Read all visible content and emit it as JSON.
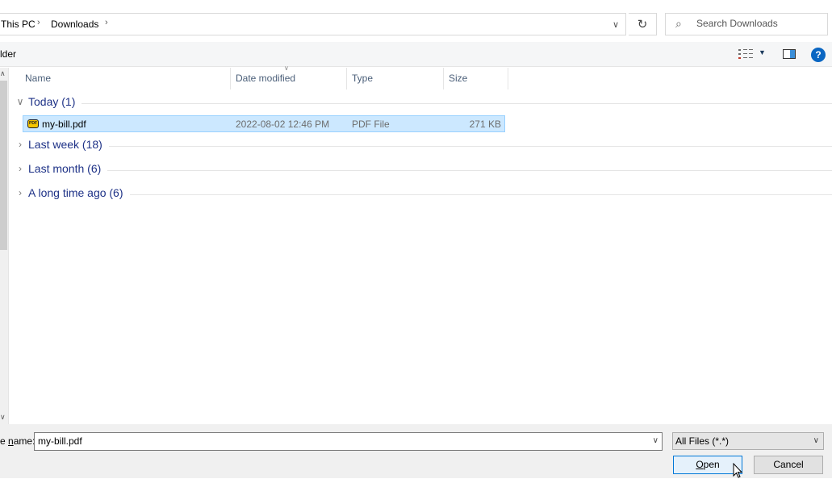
{
  "address": {
    "crumbs": [
      "This PC",
      "Downloads"
    ],
    "separator": "›",
    "dropdown_icon": "chevron-down-icon",
    "refresh_icon": "refresh-icon"
  },
  "search": {
    "placeholder": "Search Downloads",
    "value": ""
  },
  "toolbar": {
    "new_folder_label": "lder",
    "view_icon": "details-view-icon",
    "preview_icon": "preview-pane-icon",
    "help_label": "?"
  },
  "columns": [
    {
      "label": "Name"
    },
    {
      "label": "Date modified"
    },
    {
      "label": "Type"
    },
    {
      "label": "Size"
    }
  ],
  "groups": [
    {
      "label": "Today (1)",
      "expanded": true
    },
    {
      "label": "Last week (18)",
      "expanded": false
    },
    {
      "label": "Last month (6)",
      "expanded": false
    },
    {
      "label": "A long time ago (6)",
      "expanded": false
    }
  ],
  "files": [
    {
      "name": "my-bill.pdf",
      "date": "2022-08-02 12:46 PM",
      "type": "PDF File",
      "size": "271 KB",
      "icon_text": "PDF",
      "selected": true
    }
  ],
  "bottom": {
    "filename_label_prefix": "e ",
    "filename_label_accel": "n",
    "filename_label_rest": "ame:",
    "filename_value": "my-bill.pdf",
    "filter_value": "All Files (*.*)",
    "open_accel": "O",
    "open_rest": "pen",
    "cancel_label": "Cancel"
  }
}
